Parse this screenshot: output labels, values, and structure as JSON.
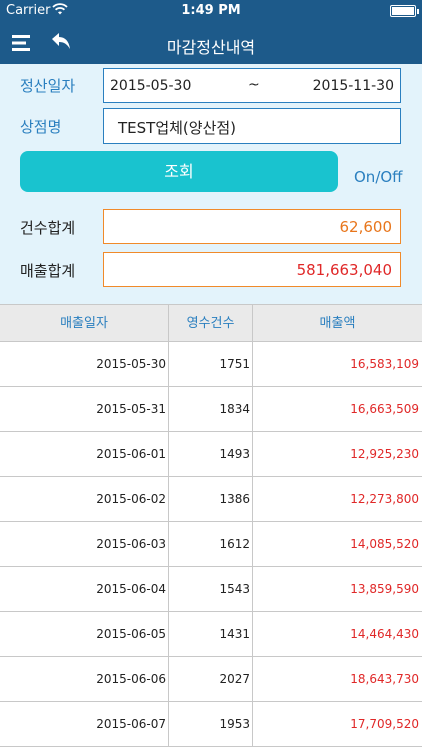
{
  "status": {
    "carrier": "Carrier",
    "time": "1:49 PM"
  },
  "nav": {
    "title": "마감정산내역"
  },
  "form": {
    "date_label": "정산일자",
    "date_start": "2015-05-30",
    "date_sep": "~",
    "date_end": "2015-11-30",
    "store_label": "상점명",
    "store_value": "TEST업체(양산점)",
    "search_label": "조회",
    "onoff_label": "On/Off",
    "count_total_label": "건수합계",
    "count_total_value": "62,600",
    "sales_total_label": "매출합계",
    "sales_total_value": "581,663,040"
  },
  "table": {
    "headers": [
      "매출일자",
      "영수건수",
      "매출액"
    ],
    "rows": [
      {
        "date": "2015-05-30",
        "count": "1751",
        "amount": "16,583,109"
      },
      {
        "date": "2015-05-31",
        "count": "1834",
        "amount": "16,663,509"
      },
      {
        "date": "2015-06-01",
        "count": "1493",
        "amount": "12,925,230"
      },
      {
        "date": "2015-06-02",
        "count": "1386",
        "amount": "12,273,800"
      },
      {
        "date": "2015-06-03",
        "count": "1612",
        "amount": "14,085,520"
      },
      {
        "date": "2015-06-04",
        "count": "1543",
        "amount": "13,859,590"
      },
      {
        "date": "2015-06-05",
        "count": "1431",
        "amount": "14,464,430"
      },
      {
        "date": "2015-06-06",
        "count": "2027",
        "amount": "18,643,730"
      },
      {
        "date": "2015-06-07",
        "count": "1953",
        "amount": "17,709,520"
      }
    ]
  },
  "colors": {
    "nav_bg": "#1d5a8a",
    "form_bg": "#e3f3fb",
    "accent_blue": "#2a7fbf",
    "button_teal": "#19c3cf",
    "total_orange": "#e8761c",
    "amount_red": "#e02828"
  },
  "icons": {
    "menu": "hamburger-icon",
    "back": "back-arrow-icon",
    "wifi": "wifi-icon",
    "battery": "battery-icon"
  }
}
